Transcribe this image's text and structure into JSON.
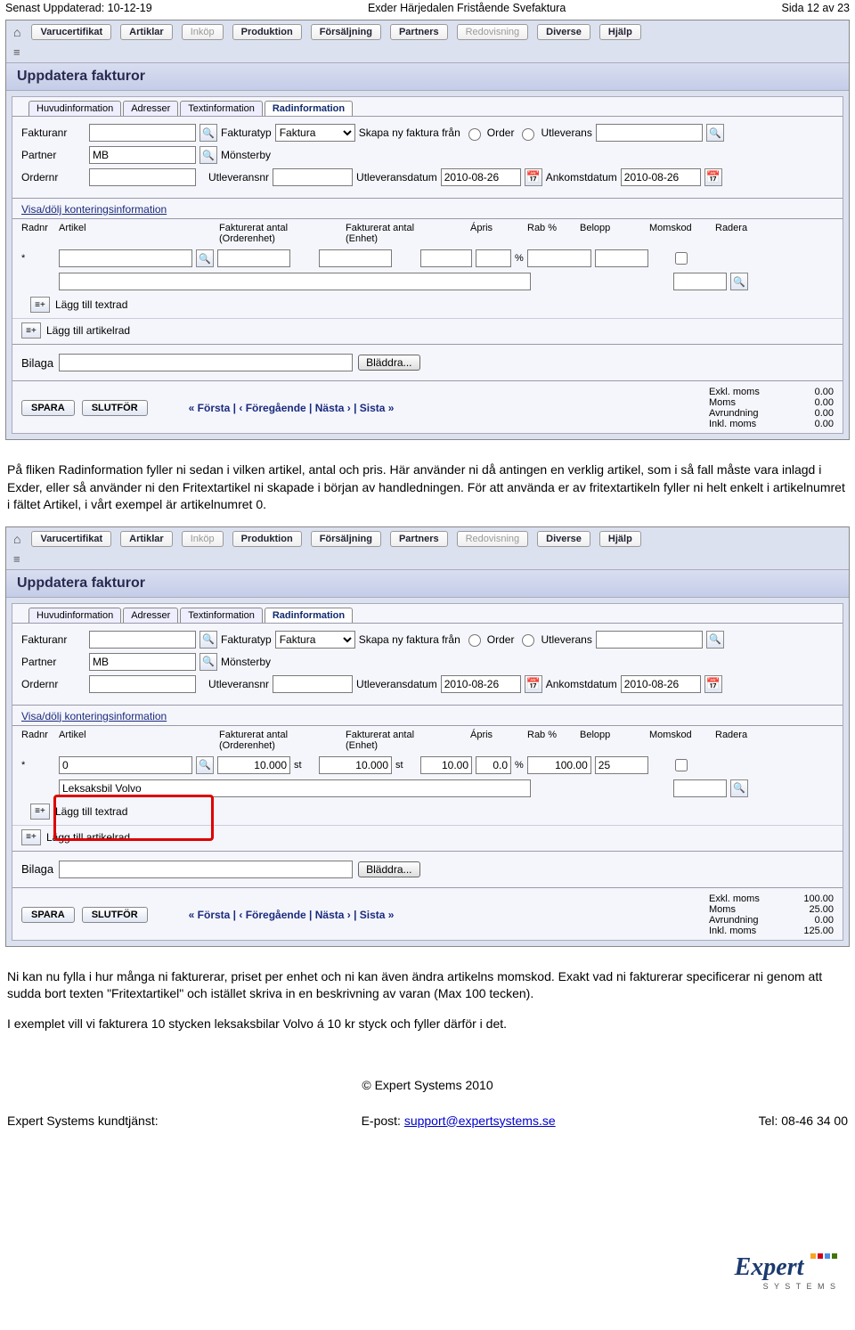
{
  "page_header": {
    "left": "Senast Uppdaterad: 10-12-19",
    "center": "Exder Härjedalen Fristående Svefaktura",
    "right": "Sida 12 av 23"
  },
  "menu": [
    "Varucertifikat",
    "Artiklar",
    "Inköp",
    "Produktion",
    "Försäljning",
    "Partners",
    "Redovisning",
    "Diverse",
    "Hjälp"
  ],
  "menu_dim": [
    2,
    6
  ],
  "section_title": "Uppdatera fakturor",
  "tabs": [
    "Huvudinformation",
    "Adresser",
    "Textinformation",
    "Radinformation"
  ],
  "tab_active": 3,
  "form": {
    "fakturanr_lbl": "Fakturanr",
    "fakturatyp_lbl": "Fakturatyp",
    "fakturatyp_val": "Faktura",
    "skapa_lbl": "Skapa ny faktura från",
    "order_lbl": "Order",
    "utleverans_lbl": "Utleverans",
    "partner_lbl": "Partner",
    "partner_val": "MB",
    "partner_name": "Mönsterby",
    "ordernr_lbl": "Ordernr",
    "utleveransnr_lbl": "Utleveransnr",
    "utleveransdatum_lbl": "Utleveransdatum",
    "utleveransdatum_val": "2010-08-26",
    "ankomstdatum_lbl": "Ankomstdatum",
    "ankomstdatum_val": "2010-08-26"
  },
  "kontering_link": "Visa/dölj konteringsinformation",
  "grid": {
    "head": [
      "Radnr",
      "Artikel",
      "",
      "Fakturerat antal (Orderenhet)",
      "",
      "Fakturerat antal (Enhet)",
      "",
      "Ápris",
      "Rab %",
      "Belopp",
      "Momskod",
      "Radera"
    ]
  },
  "grid1": {
    "radnr": "*",
    "rab_suffix": "%",
    "add_text": "Lägg till textrad",
    "add_article": "Lägg till artikelrad"
  },
  "grid2": {
    "radnr": "*",
    "artikel": "0",
    "fakt_order": "10.000",
    "fakt_order_unit": "st",
    "fakt_enhet": "10.000",
    "fakt_enhet_unit": "st",
    "apris": "10.00",
    "rab": "0.0",
    "rab_suffix": "%",
    "belopp": "100.00",
    "momskod": "25",
    "desc_val": "Leksaksbil Volvo",
    "add_text": "Lägg till textrad",
    "add_article": "Lägg till artikelrad"
  },
  "bilaga_lbl": "Bilaga",
  "bladdra_lbl": "Bläddra...",
  "buttons": {
    "spara": "SPARA",
    "slutfor": "SLUTFÖR"
  },
  "pager": "«  Första  |  ‹  Föregående  |  Nästa  ›  |  Sista  »",
  "totals1": [
    {
      "l": "Exkl. moms",
      "v": "0.00"
    },
    {
      "l": "Moms",
      "v": "0.00"
    },
    {
      "l": "Avrundning",
      "v": "0.00"
    },
    {
      "l": "Inkl. moms",
      "v": "0.00"
    }
  ],
  "totals2": [
    {
      "l": "Exkl. moms",
      "v": "100.00"
    },
    {
      "l": "Moms",
      "v": "25.00"
    },
    {
      "l": "Avrundning",
      "v": "0.00"
    },
    {
      "l": "Inkl. moms",
      "v": "125.00"
    }
  ],
  "para1": "På fliken Radinformation fyller ni sedan i vilken artikel, antal och pris. Här använder ni då antingen en verklig artikel, som i så fall måste vara inlagd i Exder, eller så använder ni den Fritextartikel ni skapade i början av handledningen. För att använda er av fritextartikeln fyller ni helt enkelt i artikelnumret i fältet Artikel, i vårt exempel är artikelnumret 0.",
  "para2": "Ni kan nu fylla i hur många ni fakturerar, priset per enhet och ni kan även ändra artikelns momskod. Exakt vad ni fakturerar specificerar ni genom att sudda bort texten \"Fritextartikel\" och istället skriva in en beskrivning av varan (Max 100 tecken).",
  "para3": "I exemplet vill vi fakturera 10 stycken leksaksbilar Volvo á 10 kr styck och fyller därför i det.",
  "footer": {
    "copyright": "© Expert Systems 2010",
    "left": "Expert Systems kundtjänst:",
    "center_lbl": "E-post:",
    "center_link": "support@expertsystems.se",
    "right": "Tel: 08-46 34 00"
  },
  "logo": {
    "name": "Expert",
    "sub": "S Y S T E M S"
  }
}
